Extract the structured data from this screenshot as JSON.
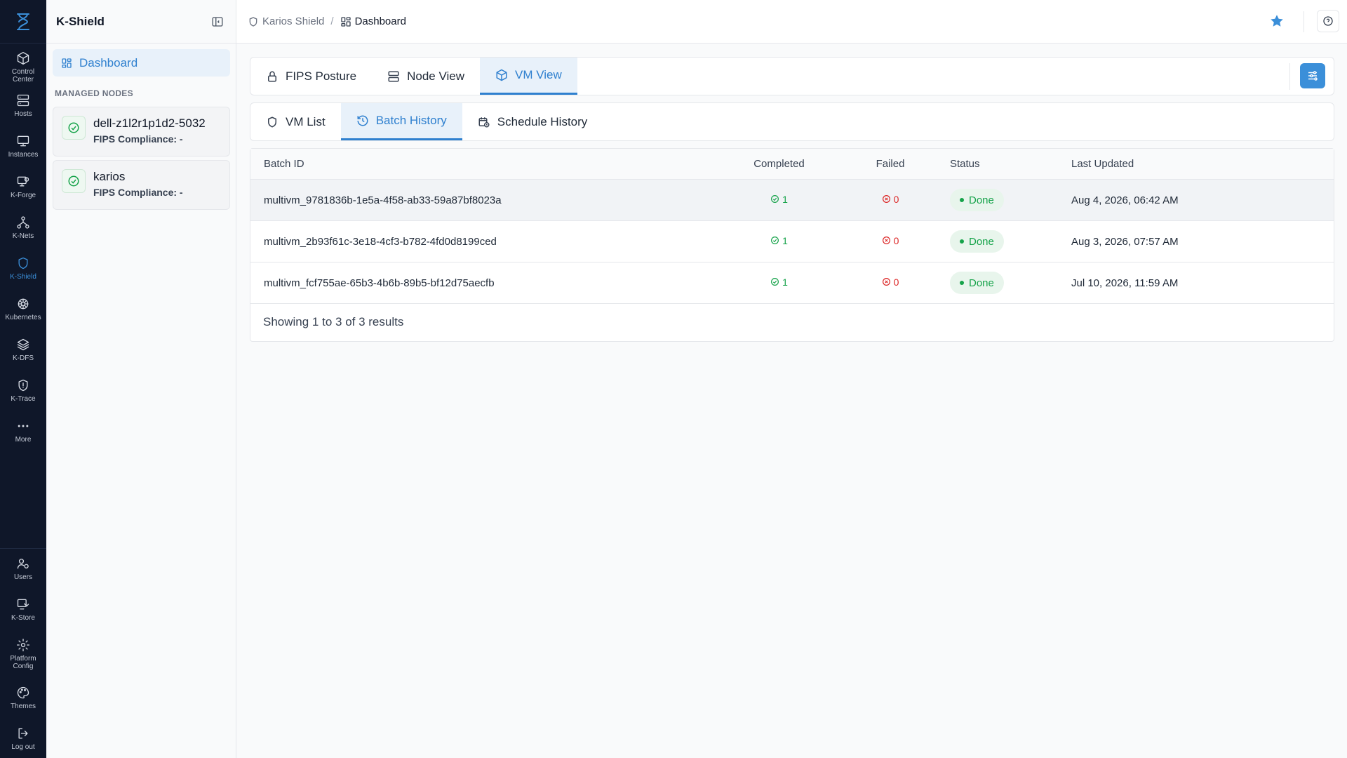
{
  "rail": {
    "top_items": [
      {
        "label": "Control\nCenter",
        "icon": "cube-icon"
      },
      {
        "label": "Hosts",
        "icon": "server-icon"
      },
      {
        "label": "Instances",
        "icon": "monitor-icon"
      },
      {
        "label": "K-Forge",
        "icon": "forge-icon"
      },
      {
        "label": "K-Nets",
        "icon": "network-icon"
      },
      {
        "label": "K-Shield",
        "icon": "shield-icon",
        "active": true
      },
      {
        "label": "Kubernetes",
        "icon": "helm-icon"
      },
      {
        "label": "K-DFS",
        "icon": "layers-icon"
      },
      {
        "label": "K-Trace",
        "icon": "trace-icon"
      },
      {
        "label": "More",
        "icon": "more-icon"
      }
    ],
    "bottom_items": [
      {
        "label": "Users",
        "icon": "users-icon"
      },
      {
        "label": "K-Store",
        "icon": "store-icon"
      },
      {
        "label": "Platform\nConfig",
        "icon": "gear-icon"
      },
      {
        "label": "Themes",
        "icon": "palette-icon"
      },
      {
        "label": "Log out",
        "icon": "logout-icon"
      }
    ]
  },
  "sidebar": {
    "title": "K-Shield",
    "dashboard_label": "Dashboard",
    "section_label": "MANAGED NODES",
    "nodes": [
      {
        "name": "dell-z1l2r1p1d2-5032",
        "compliance": "FIPS Compliance: -"
      },
      {
        "name": "karios",
        "compliance": "FIPS Compliance: -"
      }
    ]
  },
  "breadcrumb": {
    "root": "Karios Shield",
    "separator": "/",
    "current": "Dashboard"
  },
  "main_tabs": [
    {
      "label": "FIPS Posture"
    },
    {
      "label": "Node View"
    },
    {
      "label": "VM View",
      "active": true
    }
  ],
  "sub_tabs": [
    {
      "label": "VM List"
    },
    {
      "label": "Batch History",
      "active": true
    },
    {
      "label": "Schedule History"
    }
  ],
  "table": {
    "columns": [
      "Batch ID",
      "Completed",
      "Failed",
      "Status",
      "Last Updated"
    ],
    "rows": [
      {
        "batch_id": "multivm_9781836b-1e5a-4f58-ab33-59a87bf8023a",
        "completed": "1",
        "failed": "0",
        "status": "Done",
        "last_updated": "Aug 4, 2026, 06:42 AM"
      },
      {
        "batch_id": "multivm_2b93f61c-3e18-4cf3-b782-4fd0d8199ced",
        "completed": "1",
        "failed": "0",
        "status": "Done",
        "last_updated": "Aug 3, 2026, 07:57 AM"
      },
      {
        "batch_id": "multivm_fcf755ae-65b3-4b6b-89b5-bf12d75aecfb",
        "completed": "1",
        "failed": "0",
        "status": "Done",
        "last_updated": "Jul 10, 2026, 11:59 AM"
      }
    ],
    "footer": "Showing 1 to 3 of 3 results"
  },
  "colors": {
    "accent": "#2f80cf",
    "rail_bg": "#0f1729",
    "success": "#16a34a",
    "danger": "#dc2626",
    "star": "#3b8fd9"
  }
}
